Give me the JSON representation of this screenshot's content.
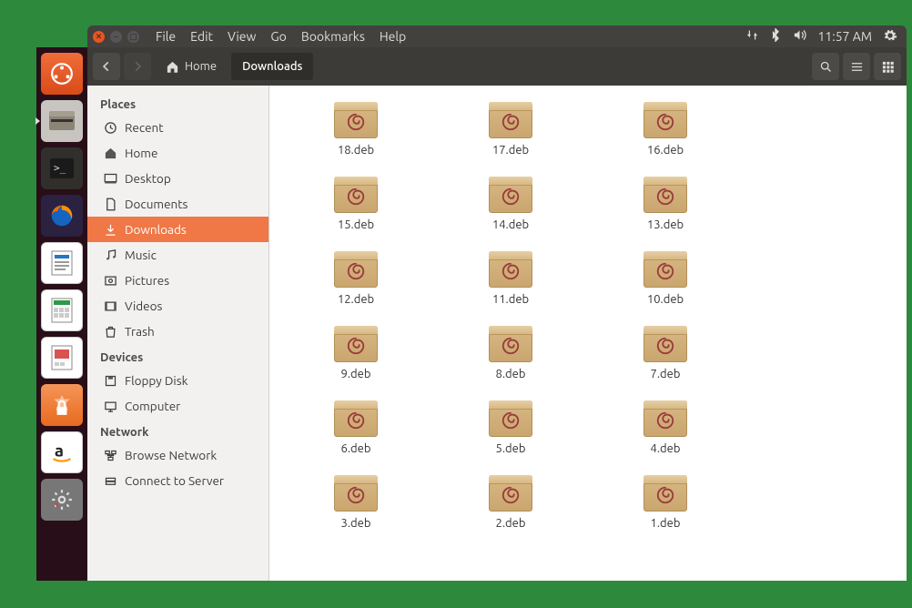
{
  "menus": {
    "file": "File",
    "edit": "Edit",
    "view": "View",
    "go": "Go",
    "bookmarks": "Bookmarks",
    "help": "Help"
  },
  "clock": "11:57 AM",
  "path": {
    "home": "Home",
    "current": "Downloads"
  },
  "sidebar": {
    "places": {
      "header": "Places",
      "recent": "Recent",
      "home": "Home",
      "desktop": "Desktop",
      "documents": "Documents",
      "downloads": "Downloads",
      "music": "Music",
      "pictures": "Pictures",
      "videos": "Videos",
      "trash": "Trash"
    },
    "devices": {
      "header": "Devices",
      "floppy": "Floppy Disk",
      "computer": "Computer"
    },
    "network": {
      "header": "Network",
      "browse": "Browse Network",
      "connect": "Connect to Server"
    }
  },
  "files": [
    "18.deb",
    "17.deb",
    "16.deb",
    "15.deb",
    "14.deb",
    "13.deb",
    "12.deb",
    "11.deb",
    "10.deb",
    "9.deb",
    "8.deb",
    "7.deb",
    "6.deb",
    "5.deb",
    "4.deb",
    "3.deb",
    "2.deb",
    "1.deb"
  ],
  "launcher": [
    {
      "name": "dash",
      "bg": "#dd4814"
    },
    {
      "name": "files",
      "bg": "#9e9e9e"
    },
    {
      "name": "terminal",
      "bg": "#2b2b2b"
    },
    {
      "name": "firefox",
      "bg": "#0a66c2"
    },
    {
      "name": "writer",
      "bg": "#ffffff"
    },
    {
      "name": "calc",
      "bg": "#ffffff"
    },
    {
      "name": "impress",
      "bg": "#ffffff"
    },
    {
      "name": "software",
      "bg": "#ea6a1e"
    },
    {
      "name": "amazon",
      "bg": "#ffffff"
    },
    {
      "name": "settings",
      "bg": "#888888"
    }
  ]
}
